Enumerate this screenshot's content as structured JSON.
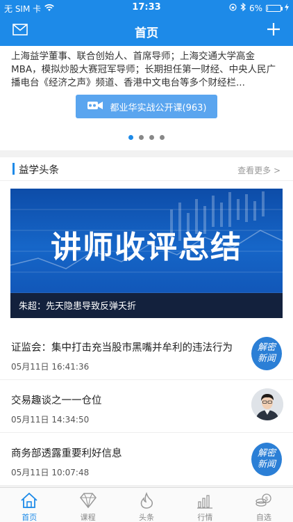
{
  "status_bar": {
    "carrier": "无 SIM 卡",
    "time": "17:33",
    "battery": "6%",
    "battery_level": 0.06
  },
  "nav": {
    "title": "首页"
  },
  "intro": {
    "text": "上海益学董事、联合创始人、首席导师；上海交通大学高金MBA，模拟炒股大赛冠军导师；长期担任第一财经、中央人民广播电台《经济之声》频道、香港中文电台等多个财经栏...",
    "course_button": "都业华实战公开课(963)"
  },
  "carousel": {
    "dot_count": 4,
    "active_index": 0
  },
  "headlines_section": {
    "title": "益学头条",
    "more": "查看更多"
  },
  "banner": {
    "big_text": "讲师收评总结",
    "caption": "朱超：先天隐患导致反弹夭折"
  },
  "news": [
    {
      "headline": "证监会：集中打击充当股市黑嘴并牟利的违法行为",
      "time": "05月11日 16:41:36",
      "thumb": "badge",
      "badge_line1": "解密",
      "badge_line2": "新闻"
    },
    {
      "headline": "交易趣谈之一一仓位",
      "time": "05月11日 14:34:50",
      "thumb": "avatar"
    },
    {
      "headline": "商务部透露重要利好信息",
      "time": "05月11日 10:07:48",
      "thumb": "badge",
      "badge_line1": "解密",
      "badge_line2": "新闻"
    }
  ],
  "tabs": [
    {
      "label": "首页",
      "icon": "home-icon",
      "active": true
    },
    {
      "label": "课程",
      "icon": "diamond-icon",
      "active": false
    },
    {
      "label": "头条",
      "icon": "flame-icon",
      "active": false
    },
    {
      "label": "行情",
      "icon": "bar-chart-icon",
      "active": false
    },
    {
      "label": "自选",
      "icon": "coins-icon",
      "active": false
    }
  ],
  "colors": {
    "brand": "#1d8ae8",
    "badge": "#2b7fd6"
  }
}
